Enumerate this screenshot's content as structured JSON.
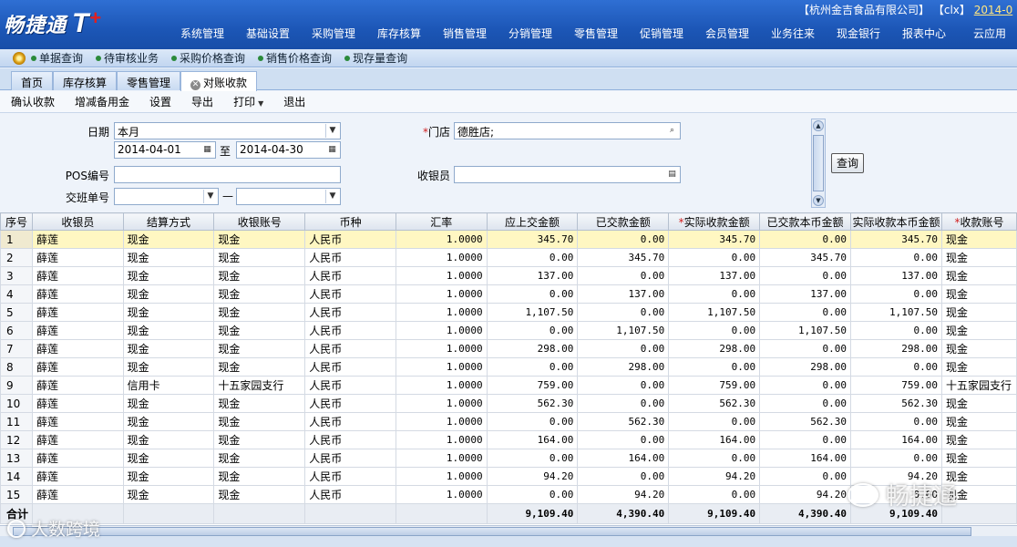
{
  "app": {
    "logo_text": "畅捷通",
    "logo_t": "T",
    "logo_plus": "+",
    "company": "【杭州金吉食品有限公司】",
    "user": "【clx】",
    "date": "2014-0"
  },
  "main_nav": [
    "系统管理",
    "基础设置",
    "采购管理",
    "库存核算",
    "销售管理",
    "分销管理",
    "零售管理",
    "促销管理",
    "会员管理",
    "业务往来",
    "现金银行",
    "报表中心",
    "云应用"
  ],
  "quick_links": [
    "单据查询",
    "待审核业务",
    "采购价格查询",
    "销售价格查询",
    "现存量查询"
  ],
  "tabs": [
    {
      "label": "首页"
    },
    {
      "label": "库存核算"
    },
    {
      "label": "零售管理"
    },
    {
      "label": "对账收款",
      "close": "✕"
    }
  ],
  "toolbar": {
    "confirm": "确认收款",
    "reserve": "增减备用金",
    "settings": "设置",
    "export": "导出",
    "print": "打印",
    "exit": "退出"
  },
  "filters": {
    "date_label": "日期",
    "date_range": "本月",
    "date_from": "2014-04-01",
    "to_label": "至",
    "date_to": "2014-04-30",
    "store_label": "门店",
    "store_value": "德胜店;",
    "pos_label": "POS编号",
    "pos_value": "",
    "cashier_label": "收银员",
    "cashier_value": "",
    "shift_label": "交班单号",
    "shift_from": "",
    "shift_sep": "—",
    "shift_to": "",
    "query_button": "查询"
  },
  "table": {
    "headers": [
      "序号",
      "收银员",
      "结算方式",
      "收银账号",
      "币种",
      "汇率",
      "应上交金额",
      "已交款金额",
      "实际收款金额",
      "已交款本币金额",
      "实际收款本币金额",
      "收款账号"
    ],
    "required_marks": {
      "8": "*",
      "11": "*"
    },
    "rows": [
      [
        "1",
        "薛莲",
        "现金",
        "现金",
        "人民币",
        "1.0000",
        "345.70",
        "0.00",
        "345.70",
        "0.00",
        "345.70",
        "现金"
      ],
      [
        "2",
        "薛莲",
        "现金",
        "现金",
        "人民币",
        "1.0000",
        "0.00",
        "345.70",
        "0.00",
        "345.70",
        "0.00",
        "现金"
      ],
      [
        "3",
        "薛莲",
        "现金",
        "现金",
        "人民币",
        "1.0000",
        "137.00",
        "0.00",
        "137.00",
        "0.00",
        "137.00",
        "现金"
      ],
      [
        "4",
        "薛莲",
        "现金",
        "现金",
        "人民币",
        "1.0000",
        "0.00",
        "137.00",
        "0.00",
        "137.00",
        "0.00",
        "现金"
      ],
      [
        "5",
        "薛莲",
        "现金",
        "现金",
        "人民币",
        "1.0000",
        "1,107.50",
        "0.00",
        "1,107.50",
        "0.00",
        "1,107.50",
        "现金"
      ],
      [
        "6",
        "薛莲",
        "现金",
        "现金",
        "人民币",
        "1.0000",
        "0.00",
        "1,107.50",
        "0.00",
        "1,107.50",
        "0.00",
        "现金"
      ],
      [
        "7",
        "薛莲",
        "现金",
        "现金",
        "人民币",
        "1.0000",
        "298.00",
        "0.00",
        "298.00",
        "0.00",
        "298.00",
        "现金"
      ],
      [
        "8",
        "薛莲",
        "现金",
        "现金",
        "人民币",
        "1.0000",
        "0.00",
        "298.00",
        "0.00",
        "298.00",
        "0.00",
        "现金"
      ],
      [
        "9",
        "薛莲",
        "信用卡",
        "十五家园支行",
        "人民币",
        "1.0000",
        "759.00",
        "0.00",
        "759.00",
        "0.00",
        "759.00",
        "十五家园支行"
      ],
      [
        "10",
        "薛莲",
        "现金",
        "现金",
        "人民币",
        "1.0000",
        "562.30",
        "0.00",
        "562.30",
        "0.00",
        "562.30",
        "现金"
      ],
      [
        "11",
        "薛莲",
        "现金",
        "现金",
        "人民币",
        "1.0000",
        "0.00",
        "562.30",
        "0.00",
        "562.30",
        "0.00",
        "现金"
      ],
      [
        "12",
        "薛莲",
        "现金",
        "现金",
        "人民币",
        "1.0000",
        "164.00",
        "0.00",
        "164.00",
        "0.00",
        "164.00",
        "现金"
      ],
      [
        "13",
        "薛莲",
        "现金",
        "现金",
        "人民币",
        "1.0000",
        "0.00",
        "164.00",
        "0.00",
        "164.00",
        "0.00",
        "现金"
      ],
      [
        "14",
        "薛莲",
        "现金",
        "现金",
        "人民币",
        "1.0000",
        "94.20",
        "0.00",
        "94.20",
        "0.00",
        "94.20",
        "现金"
      ],
      [
        "15",
        "薛莲",
        "现金",
        "现金",
        "人民币",
        "1.0000",
        "0.00",
        "94.20",
        "0.00",
        "94.20",
        "0.00",
        "现金"
      ]
    ],
    "total_label": "合计",
    "totals": [
      "9,109.40",
      "4,390.40",
      "9,109.40",
      "4,390.40",
      "9,109.40"
    ]
  },
  "watermarks": {
    "left": "大数跨境",
    "right": "畅捷通"
  },
  "icons": {
    "calendar": "calendar-icon",
    "search": "search-icon",
    "dropdown": "chevron-down-icon",
    "settings": "gear-icon"
  }
}
